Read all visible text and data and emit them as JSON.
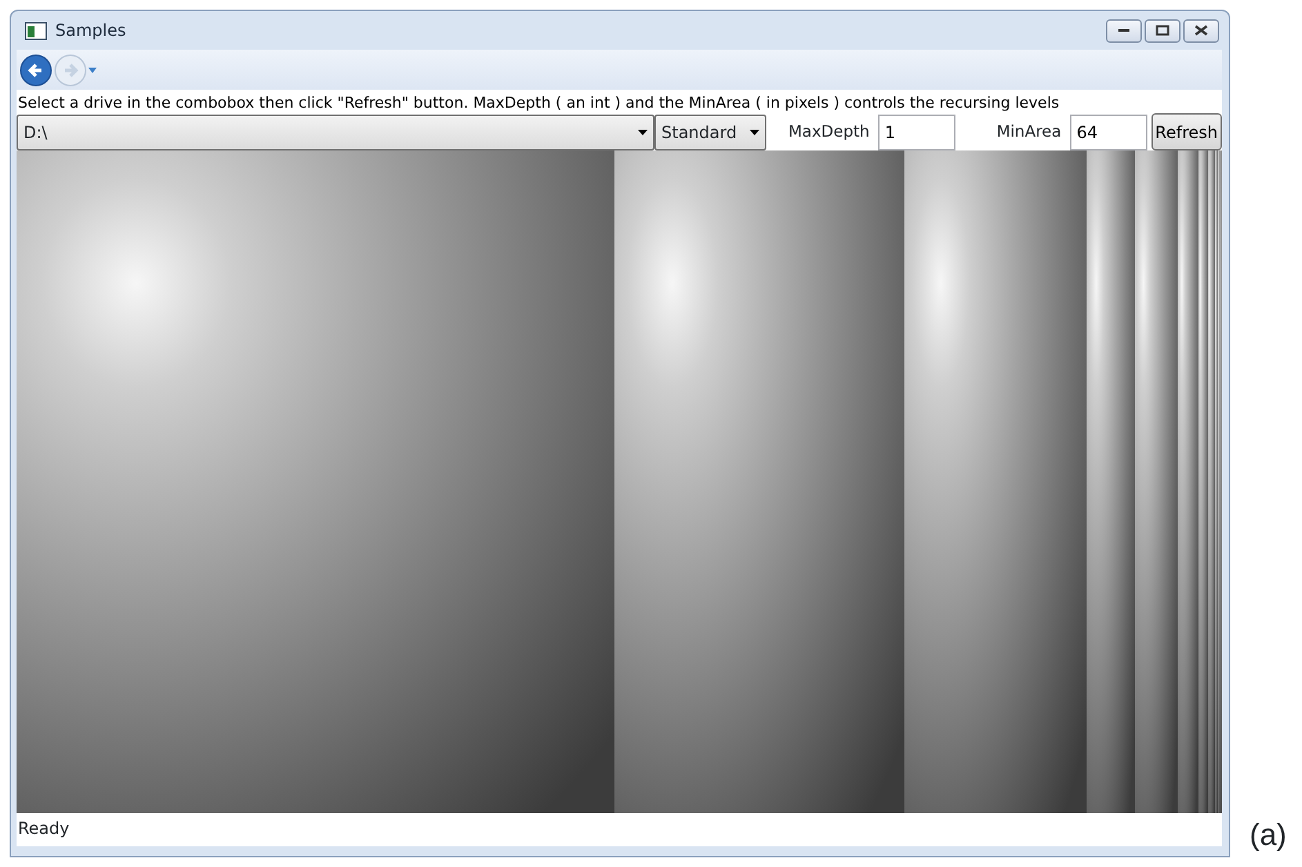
{
  "window": {
    "title": "Samples"
  },
  "navigation": {
    "back": {
      "disabled": false
    },
    "forward": {
      "disabled": true
    }
  },
  "instruction": "Select a drive in the combobox then click \"Refresh\" button. MaxDepth ( an int ) and the MinArea ( in pixels ) controls the recursing levels",
  "controls": {
    "drive": "D:\\",
    "mode": "Standard",
    "max_depth": {
      "label": "MaxDepth",
      "value": "1"
    },
    "min_area": {
      "label": "MinArea",
      "value": "64"
    },
    "refresh": "Refresh"
  },
  "status_bar": "Ready",
  "caption": "(a)"
}
